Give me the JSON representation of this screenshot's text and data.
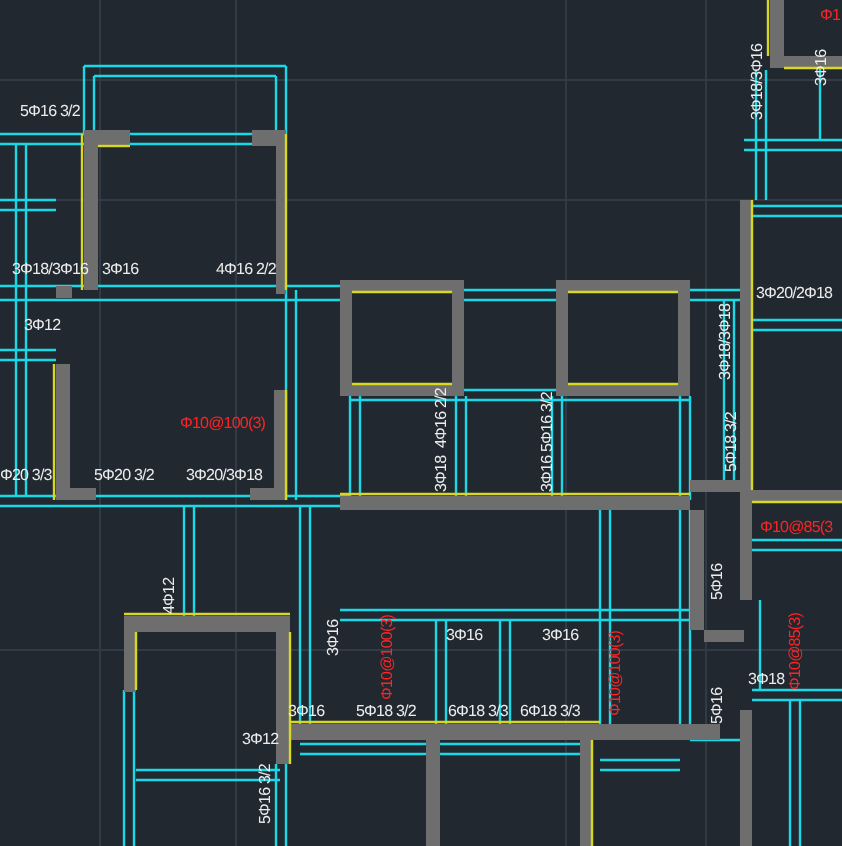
{
  "labels": [
    {
      "text": "5Φ16 3/2",
      "kind": "rebar"
    },
    {
      "text": "3Φ18/3Φ16",
      "kind": "rebar"
    },
    {
      "text": "3Φ16",
      "kind": "rebar"
    },
    {
      "text": "4Φ16 2/2",
      "kind": "rebar"
    },
    {
      "text": "3Φ12",
      "kind": "rebar"
    },
    {
      "text": "Φ10@100(3)",
      "kind": "stirrup"
    },
    {
      "text": "Φ20 3/3",
      "kind": "rebar"
    },
    {
      "text": "5Φ20 3/2",
      "kind": "rebar"
    },
    {
      "text": "3Φ20/3Φ18",
      "kind": "rebar"
    },
    {
      "text": "3Φ18/3Φ16",
      "kind": "rebar"
    },
    {
      "text": "Φ1",
      "kind": "stirrup"
    },
    {
      "text": "3Φ16",
      "kind": "rebar"
    },
    {
      "text": "3Φ20/2Φ18",
      "kind": "rebar"
    },
    {
      "text": "3Φ18/3Φ18",
      "kind": "rebar"
    },
    {
      "text": "5Φ18 3/2",
      "kind": "rebar"
    },
    {
      "text": "4Φ16 2/2",
      "kind": "rebar"
    },
    {
      "text": "3Φ18",
      "kind": "rebar"
    },
    {
      "text": "5Φ16 3/2",
      "kind": "rebar"
    },
    {
      "text": "3Φ16",
      "kind": "rebar"
    },
    {
      "text": "Φ10@85(3",
      "kind": "stirrup"
    },
    {
      "text": "5Φ16",
      "kind": "rebar"
    },
    {
      "text": "Φ10@85(3)",
      "kind": "stirrup"
    },
    {
      "text": "4Φ12",
      "kind": "rebar"
    },
    {
      "text": "3Φ16",
      "kind": "rebar"
    },
    {
      "text": "Φ10@100(3)",
      "kind": "stirrup"
    },
    {
      "text": "3Φ16",
      "kind": "rebar"
    },
    {
      "text": "3Φ16",
      "kind": "rebar"
    },
    {
      "text": "Φ10@100(3)",
      "kind": "stirrup"
    },
    {
      "text": "3Φ18",
      "kind": "rebar"
    },
    {
      "text": "3Φ16",
      "kind": "rebar"
    },
    {
      "text": "5Φ18 3/2",
      "kind": "rebar"
    },
    {
      "text": "6Φ18 3/3",
      "kind": "rebar"
    },
    {
      "text": "6Φ18 3/3",
      "kind": "rebar"
    },
    {
      "text": "5Φ16",
      "kind": "rebar"
    },
    {
      "text": "3Φ12",
      "kind": "rebar"
    },
    {
      "text": "5Φ16 3/2",
      "kind": "rebar"
    }
  ]
}
